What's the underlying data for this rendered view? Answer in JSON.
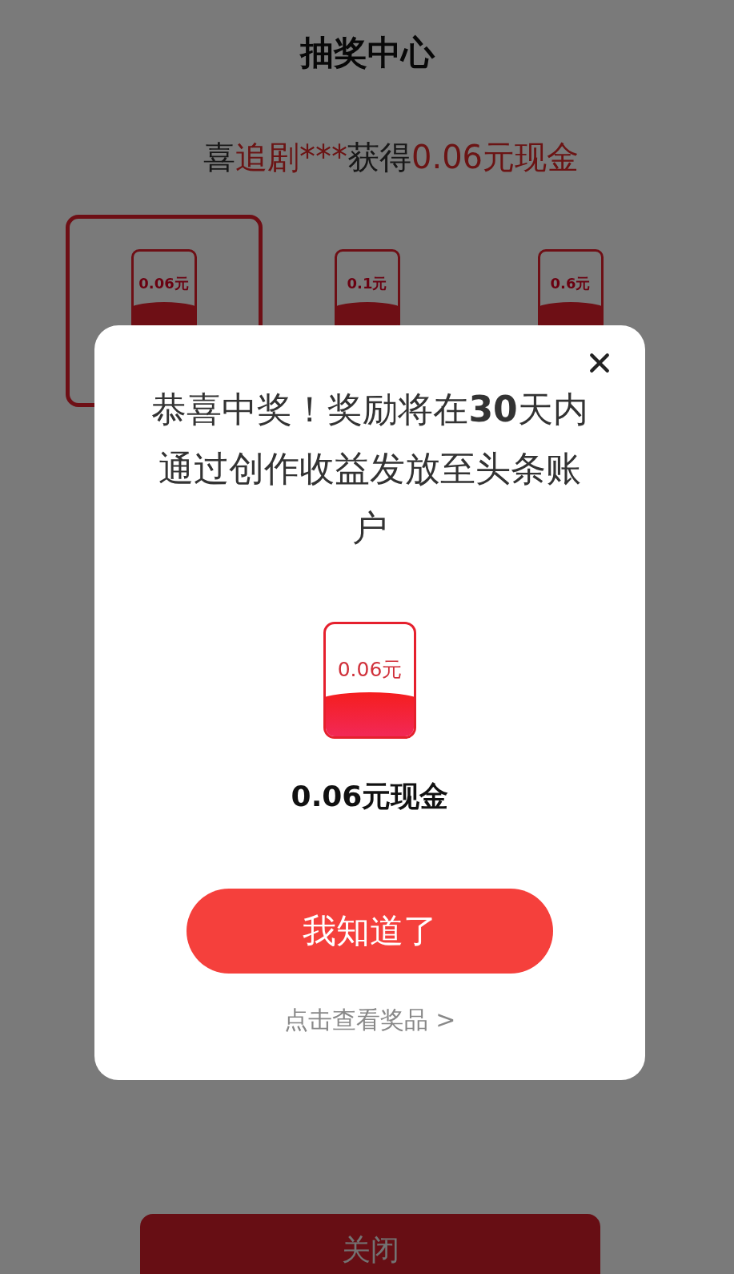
{
  "header": {
    "title": "抽奖中心"
  },
  "ticker": {
    "segments": [
      {
        "text": "喜",
        "highlight": false
      },
      {
        "text": "追剧***",
        "highlight": true
      },
      {
        "text": "获得",
        "highlight": false
      },
      {
        "text": "0.06元现金",
        "highlight": true
      }
    ]
  },
  "prizes": [
    {
      "amount": "0.06元",
      "selected": true
    },
    {
      "amount": "0.1元",
      "selected": false
    },
    {
      "amount": "0.6元",
      "selected": false
    }
  ],
  "dialog": {
    "message": "恭喜中奖！奖励将在**30**天内通过创作收益发放至头条账户",
    "prize": {
      "amount": "0.06元",
      "label": "0.06元现金"
    },
    "confirm_button": "我知道了",
    "link": "点击查看奖品 >"
  },
  "footer": {
    "button": "关闭"
  }
}
